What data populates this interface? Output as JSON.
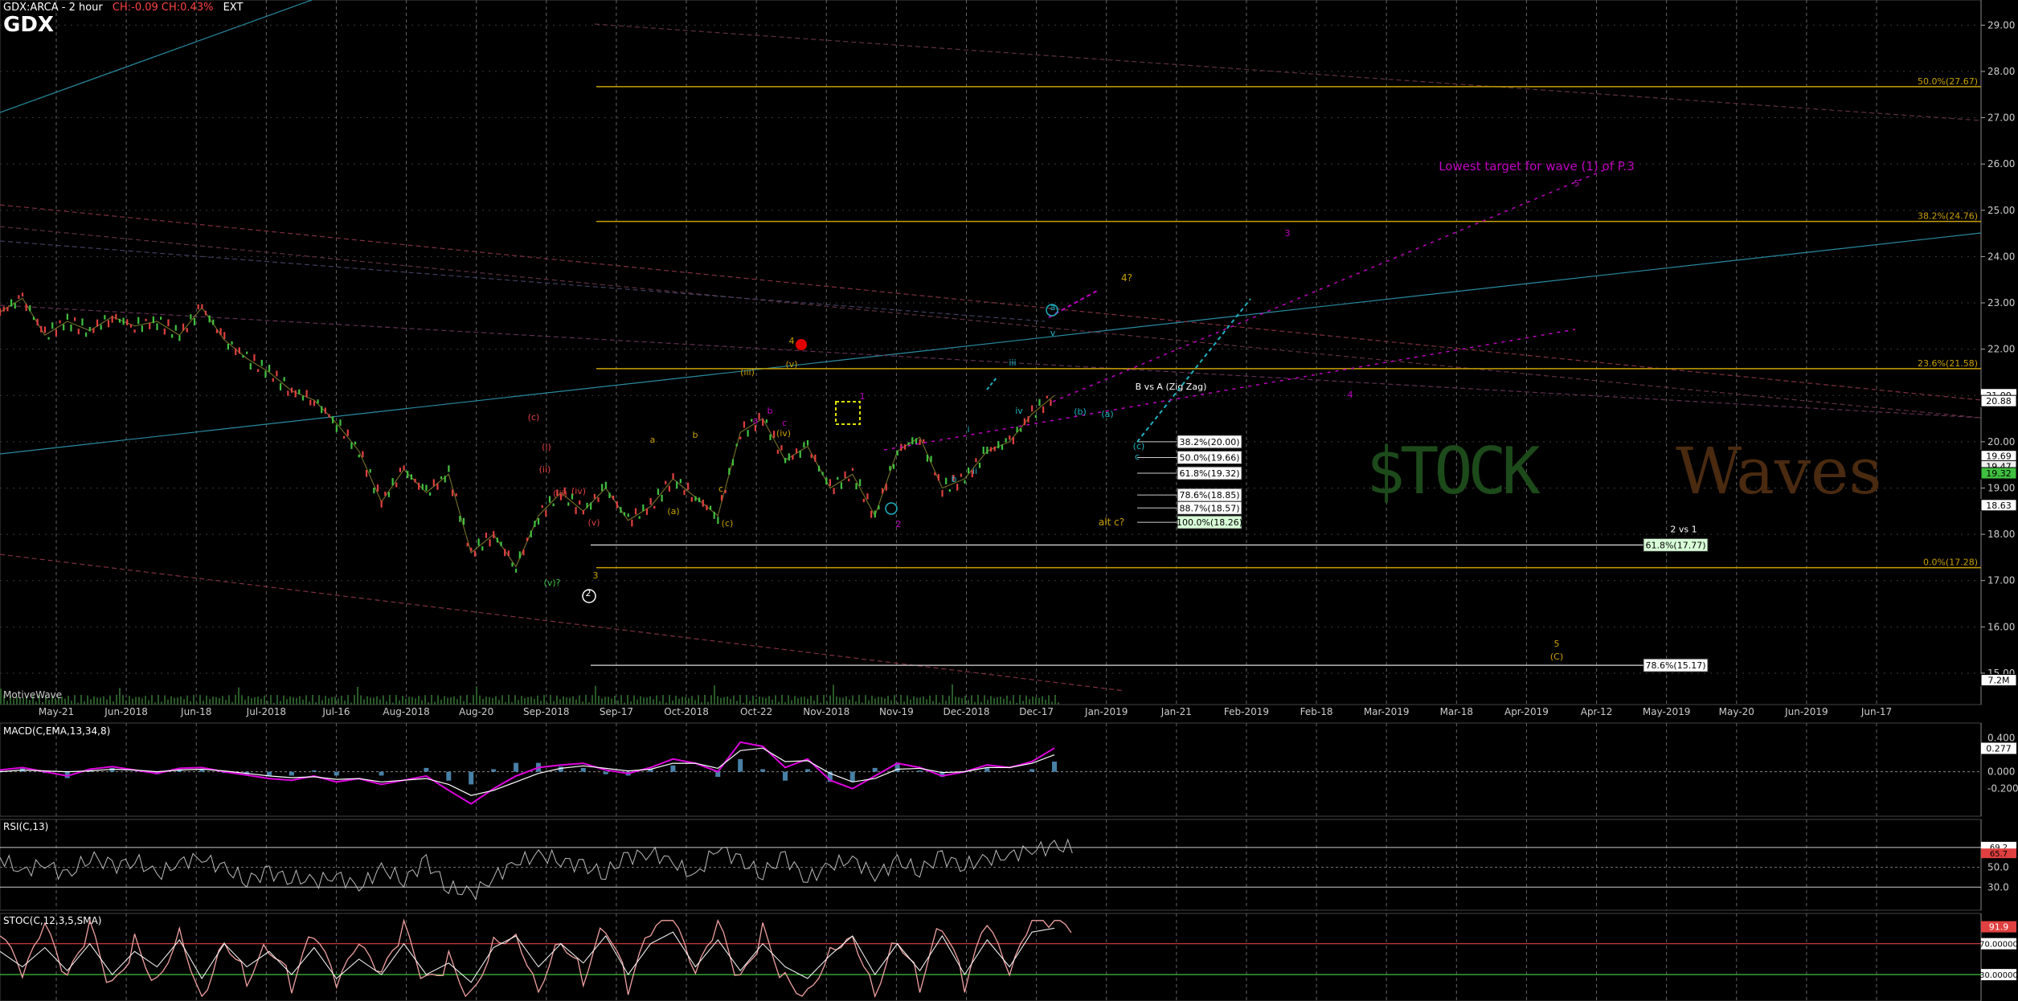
{
  "header": {
    "ticker_line": "GDX:ARCA - 2 hour",
    "change_text": "CH:-0.09  CH:0.43%",
    "ext": "EXT",
    "symbol": "GDX",
    "brand": "MotiveWave"
  },
  "watermark": {
    "left": "$TOCK",
    "right": "Waves"
  },
  "colors": {
    "background": "#000000",
    "grid": "#555555",
    "gold": "#c8a000",
    "magenta": "#c000c0",
    "cyan": "#20b0c0",
    "price_up": "#40c040",
    "price_down": "#e04040"
  },
  "chart_data": [
    {
      "type": "line",
      "title": "GDX",
      "x_ticks": [
        "May-21",
        "Jun-2018",
        "Jun-18",
        "Jul-2018",
        "Jul-16",
        "Aug-2018",
        "Aug-20",
        "Sep-2018",
        "Sep-17",
        "Oct-2018",
        "Oct-22",
        "Nov-2018",
        "Nov-19",
        "Dec-2018",
        "Dec-17",
        "Jan-2019",
        "Jan-21",
        "Feb-2019",
        "Feb-18",
        "Mar-2019",
        "Mar-18",
        "Apr-2019",
        "Apr-12",
        "May-2019",
        "May-20",
        "Jun-2019",
        "Jun-17"
      ],
      "y_ticks": [
        "29.00",
        "28.00",
        "27.00",
        "26.00",
        "25.00",
        "24.00",
        "23.00",
        "22.00",
        "21.00",
        "20.00",
        "19.00",
        "18.00",
        "17.00",
        "16.00",
        "15.00"
      ],
      "ylim": [
        14.6,
        29.3
      ],
      "price_path": [
        22.8,
        23.1,
        22.3,
        22.6,
        22.4,
        22.7,
        22.5,
        22.6,
        22.3,
        22.9,
        22.2,
        21.8,
        21.5,
        21.1,
        20.9,
        20.4,
        19.8,
        18.7,
        19.4,
        18.9,
        19.3,
        17.6,
        18.0,
        17.3,
        18.4,
        18.9,
        18.5,
        19.0,
        18.3,
        18.6,
        19.2,
        18.8,
        18.4,
        20.2,
        20.5,
        19.6,
        19.9,
        19.0,
        19.3,
        18.4,
        19.8,
        20.1,
        19.0,
        19.2,
        19.8,
        20.0,
        20.6,
        21.0
      ],
      "current_price_label": "21.00",
      "price_axis_tags": [
        "20.88",
        "19.69",
        "19.47",
        "19.32",
        "18.63",
        "7.2M"
      ],
      "fibonacci_levels": [
        {
          "label": "50.0%(27.67)",
          "value": 27.67
        },
        {
          "label": "38.2%(24.76)",
          "value": 24.76
        },
        {
          "label": "23.6%(21.58)",
          "value": 21.58
        },
        {
          "label": "0.0%(17.28)",
          "value": 17.28
        }
      ],
      "b_vs_a": {
        "title": "B vs A (Zig Zag)",
        "levels": [
          {
            "label": "38.2%(20.00)",
            "value": 20.0
          },
          {
            "label": "50.0%(19.66)",
            "value": 19.66
          },
          {
            "label": "61.8%(19.32)",
            "value": 19.32
          },
          {
            "label": "78.6%(18.85)",
            "value": 18.85
          },
          {
            "label": "88.7%(18.57)",
            "value": 18.57
          },
          {
            "label": "100.0%(18.26)",
            "value": 18.26
          }
        ]
      },
      "two_vs_one": {
        "title": "2 vs 1",
        "levels": [
          {
            "label": "61.8%(17.77)",
            "value": 17.77
          },
          {
            "label": "78.6%(15.17)",
            "value": 15.17
          }
        ]
      },
      "annotations": [
        {
          "text": "Lowest target for wave (1) of P.3",
          "color": "#c000c0"
        },
        {
          "text": "alt c?",
          "color": "#c8a000"
        },
        {
          "text": "4?",
          "color": "#c8a000"
        }
      ],
      "wave_labels": [
        {
          "text": "(c)",
          "color": "#e04040"
        },
        {
          "text": "(i)",
          "color": "#e04040"
        },
        {
          "text": "(ii)",
          "color": "#e04040"
        },
        {
          "text": "(iii)",
          "color": "#e04040"
        },
        {
          "text": "(iv)",
          "color": "#e04040"
        },
        {
          "text": "(v)",
          "color": "#e04040"
        },
        {
          "text": "(v)?",
          "color": "#40c040"
        },
        {
          "text": "2",
          "color": "#ffffff"
        },
        {
          "text": "3",
          "color": "#c8a000"
        },
        {
          "text": "a",
          "color": "#c8a000"
        },
        {
          "text": "b",
          "color": "#c8a000"
        },
        {
          "text": "(a)",
          "color": "#c8a000"
        },
        {
          "text": "c",
          "color": "#c8a000"
        },
        {
          "text": "(c)",
          "color": "#c8a000"
        },
        {
          "text": "(iii)",
          "color": "#c8a000"
        },
        {
          "text": "(iv)",
          "color": "#c8a000"
        },
        {
          "text": "(v)",
          "color": "#c8a000"
        },
        {
          "text": "4",
          "color": "#c8a000"
        },
        {
          "text": "a",
          "color": "#c000c0"
        },
        {
          "text": "b",
          "color": "#c000c0"
        },
        {
          "text": "c",
          "color": "#c000c0"
        },
        {
          "text": "1",
          "color": "#c000c0"
        },
        {
          "text": "2",
          "color": "#c000c0"
        },
        {
          "text": "3",
          "color": "#c000c0"
        },
        {
          "text": "4",
          "color": "#c000c0"
        },
        {
          "text": "5",
          "color": "#c000c0"
        },
        {
          "text": "(a)",
          "color": "#20b0c0"
        },
        {
          "text": "(b)",
          "color": "#20b0c0"
        },
        {
          "text": "(c)",
          "color": "#20b0c0"
        },
        {
          "text": "a",
          "color": "#20b0c0"
        },
        {
          "text": "b",
          "color": "#20b0c0"
        },
        {
          "text": "c",
          "color": "#20b0c0"
        },
        {
          "text": "i",
          "color": "#20b0c0"
        },
        {
          "text": "ii",
          "color": "#20b0c0"
        },
        {
          "text": "iii",
          "color": "#20b0c0"
        },
        {
          "text": "iv",
          "color": "#20b0c0"
        },
        {
          "text": "v",
          "color": "#20b0c0"
        },
        {
          "text": "5",
          "color": "#c8a000"
        },
        {
          "text": "(C)",
          "color": "#c8a000"
        }
      ]
    },
    {
      "type": "line",
      "title": "MACD(C,EMA,13,34,8)",
      "y_ticks": [
        "0.400",
        "0.000",
        "-0.200"
      ],
      "ylim": [
        -0.45,
        0.5
      ],
      "current_value_label": "0.277",
      "macd": [
        0.02,
        0.05,
        0.0,
        -0.05,
        0.03,
        0.06,
        0.02,
        -0.02,
        0.04,
        0.05,
        0.0,
        -0.04,
        -0.08,
        -0.1,
        -0.05,
        -0.12,
        -0.08,
        -0.15,
        -0.1,
        -0.05,
        -0.22,
        -0.38,
        -0.2,
        -0.05,
        0.05,
        0.08,
        0.1,
        0.02,
        -0.02,
        0.05,
        0.15,
        0.1,
        0.0,
        0.35,
        0.3,
        0.05,
        0.15,
        -0.1,
        -0.2,
        -0.05,
        0.1,
        0.05,
        -0.05,
        0.0,
        0.08,
        0.05,
        0.12,
        0.28
      ],
      "signal": [
        0.0,
        0.02,
        0.01,
        0.0,
        0.01,
        0.03,
        0.02,
        0.0,
        0.02,
        0.03,
        0.01,
        -0.02,
        -0.05,
        -0.07,
        -0.06,
        -0.09,
        -0.08,
        -0.12,
        -0.1,
        -0.08,
        -0.15,
        -0.28,
        -0.22,
        -0.12,
        -0.02,
        0.04,
        0.07,
        0.04,
        0.01,
        0.03,
        0.1,
        0.1,
        0.04,
        0.25,
        0.28,
        0.12,
        0.13,
        -0.02,
        -0.12,
        -0.08,
        0.03,
        0.04,
        -0.01,
        0.0,
        0.05,
        0.05,
        0.1,
        0.2
      ]
    },
    {
      "type": "line",
      "title": "RSI(C,13)",
      "y_ticks": [
        "70.0",
        "50.0",
        "30.0"
      ],
      "ylim": [
        10,
        95
      ],
      "current_value_labels": [
        "69.2",
        "65.7"
      ],
      "values": [
        60,
        45,
        55,
        40,
        62,
        50,
        58,
        42,
        55,
        60,
        48,
        38,
        44,
        40,
        35,
        42,
        30,
        48,
        38,
        55,
        30,
        22,
        40,
        55,
        62,
        58,
        50,
        45,
        60,
        65,
        55,
        40,
        72,
        55,
        45,
        60,
        38,
        52,
        58,
        42,
        55,
        48,
        60,
        52,
        58,
        62,
        68,
        70
      ]
    },
    {
      "type": "line",
      "title": "STOC(C,12,3,5,SMA)",
      "y_ticks": [
        "70.00000",
        "30.00000"
      ],
      "ylim": [
        0,
        105
      ],
      "current_value_label": "91.9",
      "k": [
        80,
        20,
        85,
        15,
        90,
        10,
        75,
        25,
        95,
        5,
        85,
        30,
        70,
        15,
        80,
        10,
        60,
        20,
        85,
        15,
        50,
        5,
        80,
        90,
        20,
        85,
        30,
        95,
        10,
        80,
        95,
        20,
        90,
        15,
        85,
        25,
        10,
        70,
        90,
        15,
        85,
        20,
        95,
        10,
        90,
        20,
        95,
        92
      ],
      "d": [
        60,
        40,
        65,
        35,
        70,
        30,
        60,
        40,
        75,
        25,
        70,
        40,
        60,
        30,
        65,
        25,
        50,
        30,
        70,
        30,
        45,
        20,
        65,
        80,
        40,
        70,
        45,
        80,
        30,
        70,
        85,
        40,
        75,
        35,
        70,
        40,
        25,
        55,
        80,
        30,
        70,
        35,
        80,
        30,
        75,
        40,
        85,
        90
      ]
    }
  ]
}
